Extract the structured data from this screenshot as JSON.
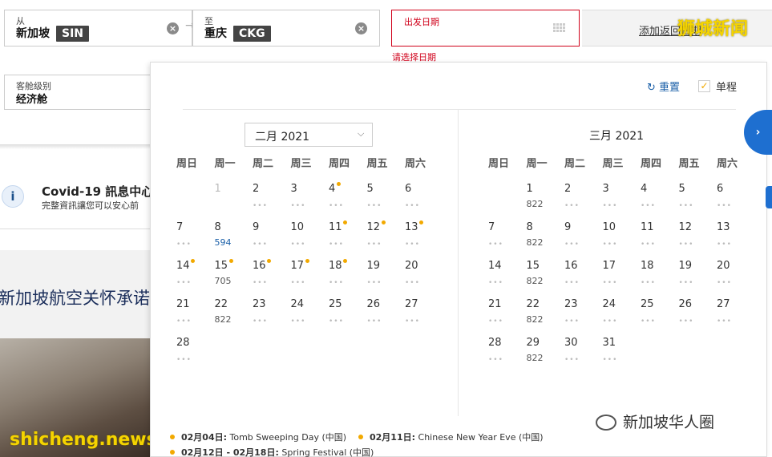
{
  "from": {
    "label": "从",
    "city": "新加坡",
    "code": "SIN"
  },
  "to": {
    "label": "至",
    "city": "重庆",
    "code": "CKG"
  },
  "depart": {
    "label": "出发日期",
    "error": "请选择日期"
  },
  "return_link": "添加返回日期",
  "watermark_top": "狮城新闻",
  "cabin": {
    "label": "客舱级别",
    "value": "经济舱"
  },
  "covid": {
    "title": "Covid-19 訊息中心",
    "sub": "完整資訊讓您可以安心前"
  },
  "promo": "新加坡航空关怀承诺",
  "reset": "重置",
  "oneway": "单程",
  "feb": {
    "title": "二月 2021",
    "weekdays": [
      "周日",
      "周一",
      "周二",
      "周三",
      "周四",
      "周五",
      "周六"
    ],
    "days": [
      {
        "n": "1",
        "c": 1,
        "dis": true
      },
      {
        "n": "2",
        "c": 2
      },
      {
        "n": "3",
        "c": 3
      },
      {
        "n": "4",
        "c": 4,
        "dot": true
      },
      {
        "n": "5",
        "c": 5
      },
      {
        "n": "6",
        "c": 6
      },
      {
        "n": "7",
        "c": 0
      },
      {
        "n": "8",
        "c": 1,
        "p": "594",
        "blue": true
      },
      {
        "n": "9",
        "c": 2
      },
      {
        "n": "10",
        "c": 3
      },
      {
        "n": "11",
        "c": 4,
        "dot": true
      },
      {
        "n": "12",
        "c": 5,
        "dot": true
      },
      {
        "n": "13",
        "c": 6,
        "dot": true
      },
      {
        "n": "14",
        "c": 0,
        "dot": true
      },
      {
        "n": "15",
        "c": 1,
        "dot": true,
        "p": "705"
      },
      {
        "n": "16",
        "c": 2,
        "dot": true
      },
      {
        "n": "17",
        "c": 3,
        "dot": true
      },
      {
        "n": "18",
        "c": 4,
        "dot": true
      },
      {
        "n": "19",
        "c": 5
      },
      {
        "n": "20",
        "c": 6
      },
      {
        "n": "21",
        "c": 0
      },
      {
        "n": "22",
        "c": 1,
        "p": "822"
      },
      {
        "n": "23",
        "c": 2
      },
      {
        "n": "24",
        "c": 3
      },
      {
        "n": "25",
        "c": 4
      },
      {
        "n": "26",
        "c": 5
      },
      {
        "n": "27",
        "c": 6
      },
      {
        "n": "28",
        "c": 0
      }
    ]
  },
  "mar": {
    "title": "三月 2021",
    "weekdays": [
      "周日",
      "周一",
      "周二",
      "周三",
      "周四",
      "周五",
      "周六"
    ],
    "days": [
      {
        "n": "1",
        "c": 1,
        "p": "822"
      },
      {
        "n": "2",
        "c": 2
      },
      {
        "n": "3",
        "c": 3
      },
      {
        "n": "4",
        "c": 4
      },
      {
        "n": "5",
        "c": 5
      },
      {
        "n": "6",
        "c": 6
      },
      {
        "n": "7",
        "c": 0
      },
      {
        "n": "8",
        "c": 1,
        "p": "822"
      },
      {
        "n": "9",
        "c": 2
      },
      {
        "n": "10",
        "c": 3
      },
      {
        "n": "11",
        "c": 4
      },
      {
        "n": "12",
        "c": 5
      },
      {
        "n": "13",
        "c": 6
      },
      {
        "n": "14",
        "c": 0
      },
      {
        "n": "15",
        "c": 1,
        "p": "822"
      },
      {
        "n": "16",
        "c": 2
      },
      {
        "n": "17",
        "c": 3
      },
      {
        "n": "18",
        "c": 4
      },
      {
        "n": "19",
        "c": 5
      },
      {
        "n": "20",
        "c": 6
      },
      {
        "n": "21",
        "c": 0
      },
      {
        "n": "22",
        "c": 1,
        "p": "822"
      },
      {
        "n": "23",
        "c": 2
      },
      {
        "n": "24",
        "c": 3
      },
      {
        "n": "25",
        "c": 4
      },
      {
        "n": "26",
        "c": 5
      },
      {
        "n": "27",
        "c": 6
      },
      {
        "n": "28",
        "c": 0
      },
      {
        "n": "29",
        "c": 1,
        "p": "822"
      },
      {
        "n": "30",
        "c": 2
      },
      {
        "n": "31",
        "c": 3
      }
    ]
  },
  "holidays": [
    {
      "date": "02月04日:",
      "name": " Tomb Sweeping Day (中国)"
    },
    {
      "date": "02月11日:",
      "name": " Chinese New Year Eve (中国)"
    },
    {
      "date": "02月12日 - 02月18日:",
      "name": " Spring Festival (中国)"
    }
  ],
  "watermark_bottom": "shicheng.news",
  "wechat_mark": "新加坡华人圈",
  "colors": {
    "error": "#d0021b",
    "link": "#1a5fa8",
    "accent": "#f2a900",
    "nav": "#1e6fd0"
  }
}
